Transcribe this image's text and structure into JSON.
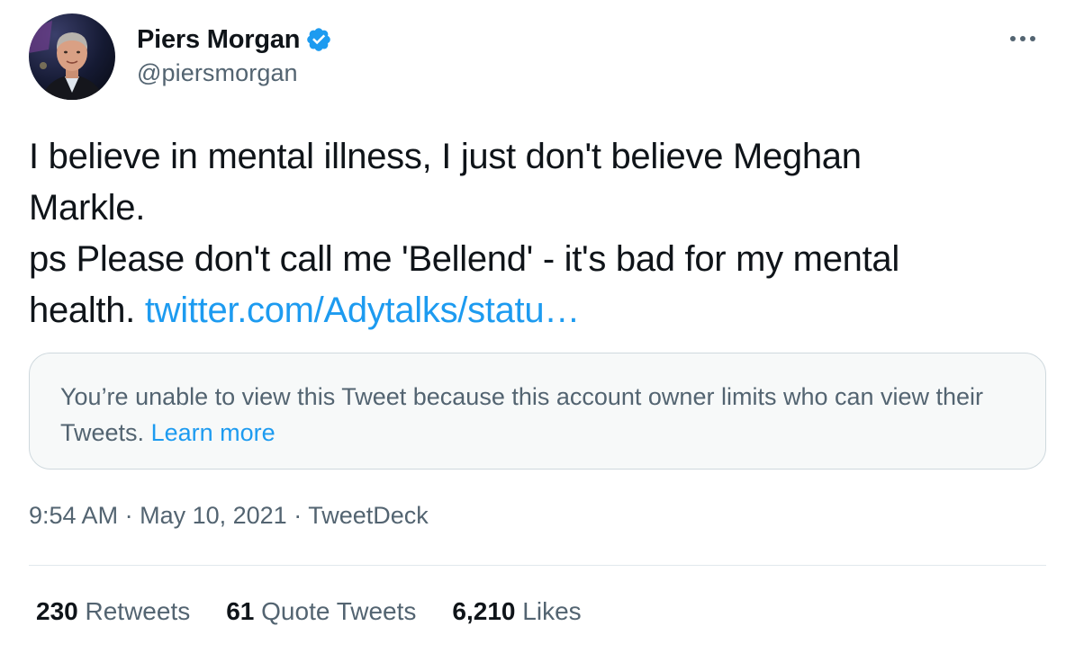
{
  "author": {
    "display_name": "Piers Morgan",
    "handle": "@piersmorgan",
    "verified": true
  },
  "tweet": {
    "lines": [
      "I believe in mental illness, I just don't believe Meghan",
      "Markle.",
      "ps Please don't call me 'Bellend' - it's bad for my mental"
    ],
    "last_line_text": "health.",
    "link_text": "twitter.com/Adytalks/statu…"
  },
  "quoted": {
    "message": "You’re unable to view this Tweet because this account owner limits who can view their Tweets.",
    "learn_more": "Learn more"
  },
  "meta": {
    "time": "9:54 AM",
    "separator": "·",
    "date": "May 10, 2021",
    "source": "TweetDeck"
  },
  "stats": {
    "retweets_count": "230",
    "retweets_label": "Retweets",
    "quote_count": "61",
    "quote_label": "Quote Tweets",
    "likes_count": "6,210",
    "likes_label": "Likes"
  },
  "colors": {
    "accent": "#1d9bf0",
    "text": "#0f1419",
    "secondary": "#536471"
  },
  "icons": {
    "verified": "verified-badge-icon",
    "more": "more-horizontal-icon"
  }
}
